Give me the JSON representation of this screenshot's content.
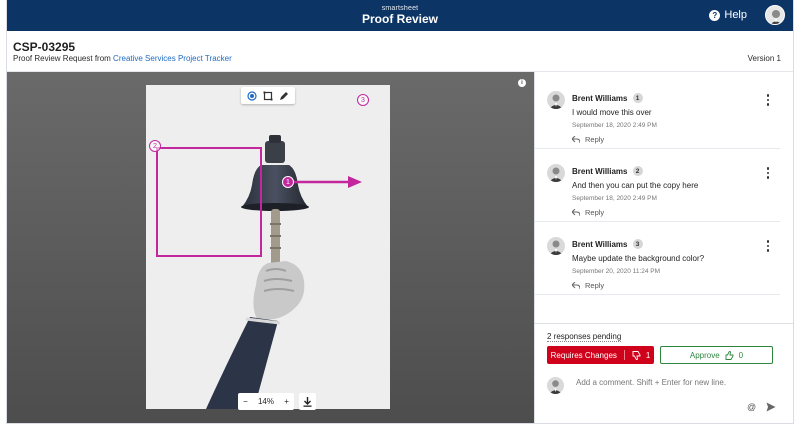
{
  "app": {
    "brand_small": "smartsheet",
    "brand_title": "Proof Review",
    "help_label": "Help"
  },
  "header": {
    "doc_id": "CSP-03295",
    "subtitle_prefix": "Proof Review Request from ",
    "subtitle_link": "Creative Services Project Tracker",
    "version": "Version 1"
  },
  "viewer": {
    "zoom_level": "14%",
    "zoom_out": "−",
    "zoom_in": "+",
    "markers": [
      "1",
      "2",
      "3"
    ],
    "tools": [
      "pin-tool-icon",
      "rectangle-tool-icon",
      "pen-tool-icon"
    ]
  },
  "comments": [
    {
      "author": "Brent Williams",
      "number": "1",
      "text": "I would move this over",
      "time": "September 18, 2020 2:49 PM",
      "reply": "Reply"
    },
    {
      "author": "Brent Williams",
      "number": "2",
      "text": "And then you can put the copy here",
      "time": "September 18, 2020 2:49 PM",
      "reply": "Reply"
    },
    {
      "author": "Brent Williams",
      "number": "3",
      "text": "Maybe update the background color?",
      "time": "September 20, 2020 11:24 PM",
      "reply": "Reply"
    }
  ],
  "review": {
    "pending": "2 responses pending",
    "requires_changes_label": "Requires Changes",
    "requires_changes_count": "1",
    "approve_label": "Approve",
    "approve_count": "0"
  },
  "compose": {
    "placeholder": "Add a comment. Shift + Enter for new line."
  },
  "colors": {
    "topbar": "#0c3566",
    "annotation": "#c2279e",
    "requires_changes": "#d0021b",
    "approve": "#2e8540",
    "link": "#1f6bc4"
  }
}
